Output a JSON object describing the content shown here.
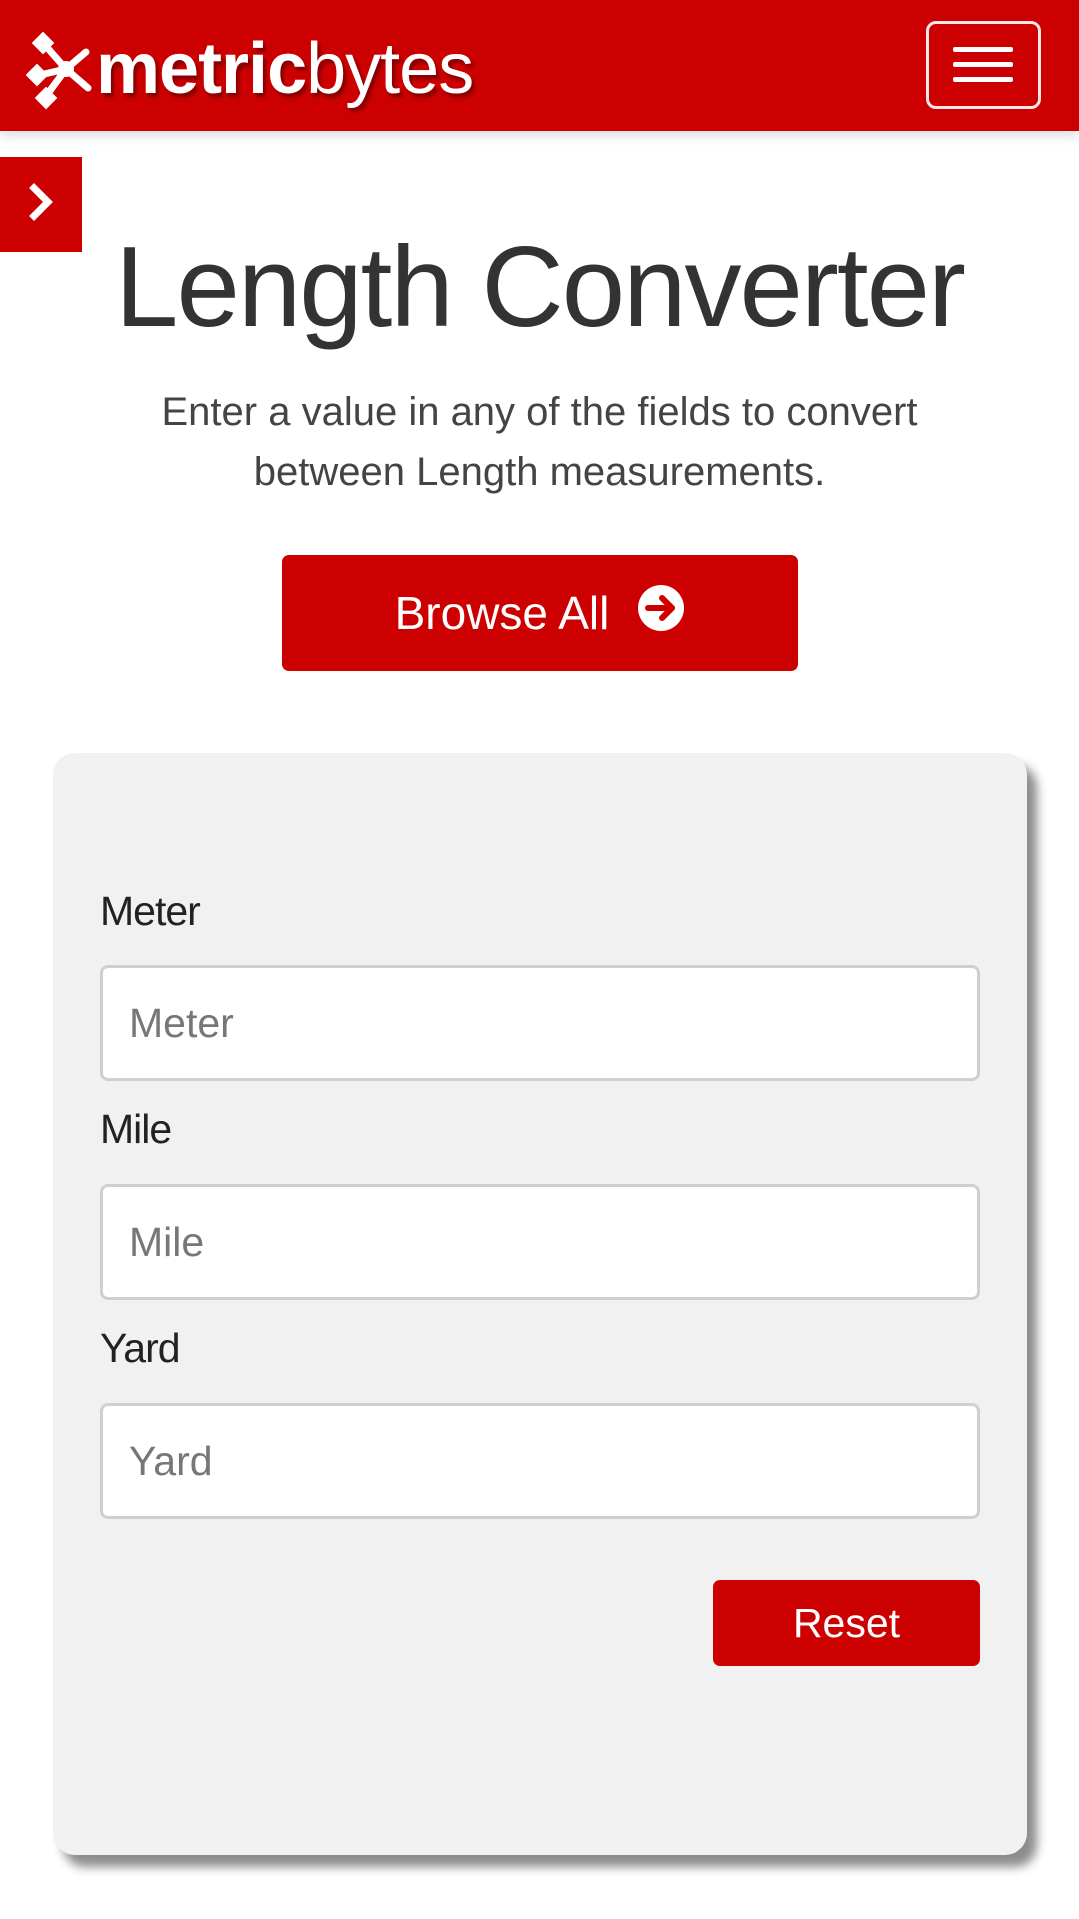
{
  "header": {
    "logo_bold": "metric",
    "logo_light": "bytes",
    "background_color": "#cc0000"
  },
  "icons": {
    "logo_mark": "network-nodes-icon",
    "menu": "hamburger-menu-icon",
    "side_toggle": "chevron-right-icon",
    "browse": "circle-arrow-right-icon"
  },
  "page": {
    "title": "Length Converter",
    "subtitle": "Enter a value in any of the fields to convert between Length measurements.",
    "browse_label": "Browse All"
  },
  "converter": {
    "fields": [
      {
        "label": "Meter",
        "placeholder": "Meter",
        "value": ""
      },
      {
        "label": "Mile",
        "placeholder": "Mile",
        "value": ""
      },
      {
        "label": "Yard",
        "placeholder": "Yard",
        "value": ""
      }
    ],
    "reset_label": "Reset"
  }
}
